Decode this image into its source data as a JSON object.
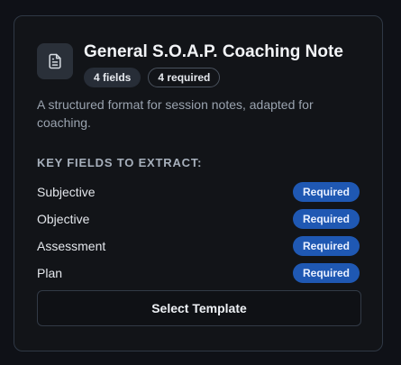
{
  "template": {
    "title": "General S.O.A.P. Coaching Note",
    "fields_pill": "4 fields",
    "required_pill": "4 required",
    "description": "A structured format for session notes, adapted for coaching.",
    "section_heading": "KEY FIELDS TO EXTRACT:",
    "fields": [
      {
        "name": "Subjective",
        "badge": "Required"
      },
      {
        "name": "Objective",
        "badge": "Required"
      },
      {
        "name": "Assessment",
        "badge": "Required"
      },
      {
        "name": "Plan",
        "badge": "Required"
      }
    ],
    "select_label": "Select Template",
    "icon": "document-icon"
  },
  "colors": {
    "background": "#0f1117",
    "card": "#121418",
    "accent_badge": "#1f58b3",
    "border": "#2f3845"
  }
}
